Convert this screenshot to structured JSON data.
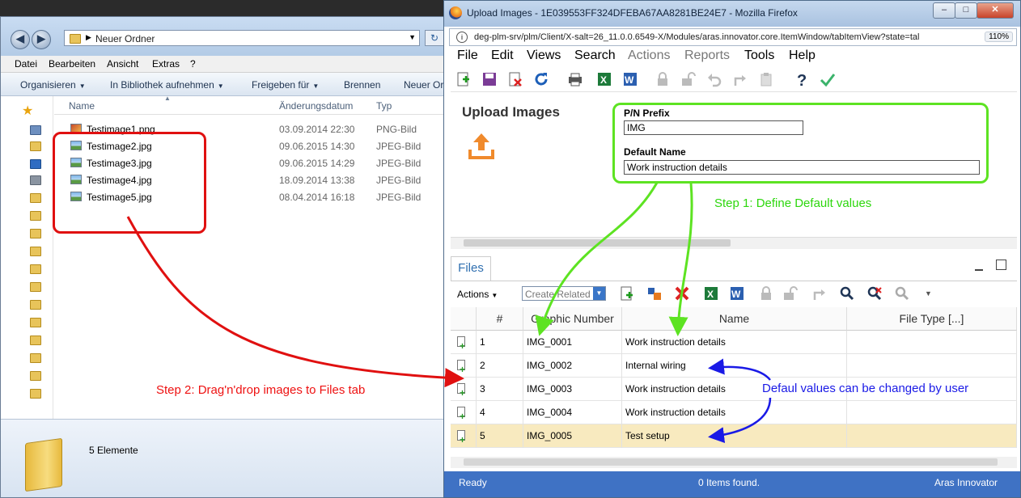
{
  "explorer": {
    "address": "Neuer Ordner",
    "menu": [
      "Datei",
      "Bearbeiten",
      "Ansicht",
      "Extras",
      "?"
    ],
    "toolbar": [
      "Organisieren",
      "In Bibliothek aufnehmen",
      "Freigeben für",
      "Brennen",
      "Neuer Or"
    ],
    "columns": {
      "name": "Name",
      "date": "Änderungsdatum",
      "type": "Typ"
    },
    "files": [
      {
        "name": "Testimage1.png",
        "date": "03.09.2014 22:30",
        "type": "PNG-Bild"
      },
      {
        "name": "Testimage2.jpg",
        "date": "09.06.2015 14:30",
        "type": "JPEG-Bild"
      },
      {
        "name": "Testimage3.jpg",
        "date": "09.06.2015 14:29",
        "type": "JPEG-Bild"
      },
      {
        "name": "Testimage4.jpg",
        "date": "18.09.2014 13:38",
        "type": "JPEG-Bild"
      },
      {
        "name": "Testimage5.jpg",
        "date": "08.04.2014 16:18",
        "type": "JPEG-Bild"
      }
    ],
    "status": "5 Elemente"
  },
  "firefox": {
    "title": "Upload Images - 1E039553FF324DFEBA67AA8281BE24E7 - Mozilla Firefox",
    "url": "deg-plm-srv/plm/Client/X-salt=26_11.0.0.6549-X/Modules/aras.innovator.core.ItemWindow/tabItemView?state=tal",
    "zoom": "110%"
  },
  "app": {
    "menu": [
      "File",
      "Edit",
      "Views",
      "Search",
      "Actions",
      "Reports",
      "Tools",
      "Help"
    ],
    "form": {
      "title": "Upload Images",
      "pn_prefix_label": "P/N Prefix",
      "pn_prefix_value": "IMG",
      "default_name_label": "Default Name",
      "default_name_value": "Work instruction details"
    },
    "files_tab": "Files",
    "actions_label": "Actions",
    "create_related": "Create Related",
    "grid": {
      "headers": [
        "#",
        "Graphic Number",
        "Name",
        "File Type [...]"
      ],
      "rows": [
        {
          "num": "1",
          "graphic": "IMG_0001",
          "name": "Work instruction details"
        },
        {
          "num": "2",
          "graphic": "IMG_0002",
          "name": "Internal wiring"
        },
        {
          "num": "3",
          "graphic": "IMG_0003",
          "name": "Work instruction details"
        },
        {
          "num": "4",
          "graphic": "IMG_0004",
          "name": "Work instruction details"
        },
        {
          "num": "5",
          "graphic": "IMG_0005",
          "name": "Test setup"
        }
      ]
    },
    "status": {
      "left": "Ready",
      "center": "0 Items found.",
      "right": "Aras Innovator"
    }
  },
  "annotations": {
    "step1": "Step 1: Define Default values",
    "step2": "Step 2: Drag'n'drop images to Files tab",
    "note": "Defaul values can be changed by user"
  },
  "colors": {
    "red": "#e01010",
    "green": "#5de322",
    "blue": "#1a1ae6",
    "status_blue": "#3f72c4"
  }
}
